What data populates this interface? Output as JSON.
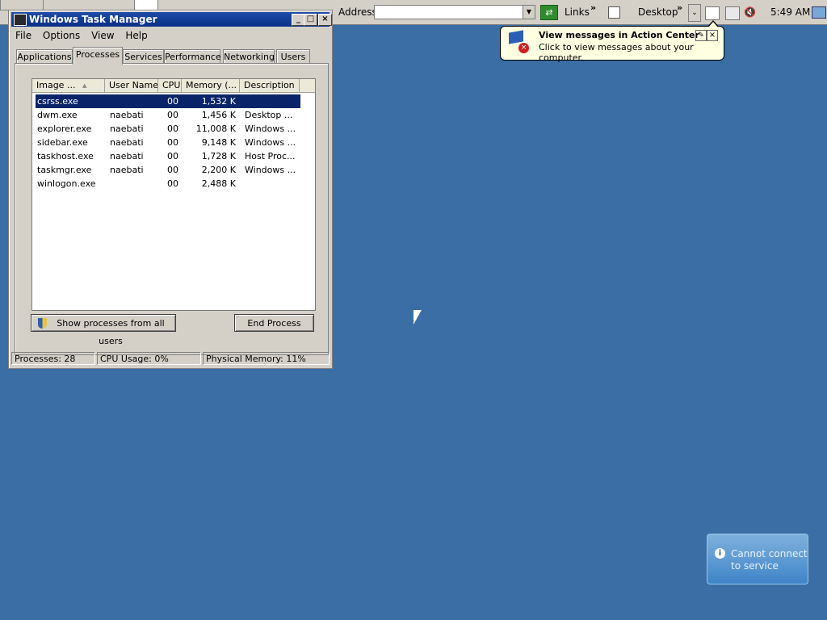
{
  "taskbar": {
    "address_label": "Address",
    "address_value": "",
    "links_label": "Links",
    "desktop_label": "Desktop",
    "chevron": "»",
    "clock": "5:49 AM"
  },
  "task_manager": {
    "title": "Windows Task Manager",
    "menu": [
      "File",
      "Options",
      "View",
      "Help"
    ],
    "tabs": [
      "Applications",
      "Processes",
      "Services",
      "Performance",
      "Networking",
      "Users"
    ],
    "active_tab": "Processes",
    "columns": [
      "Image ...",
      "User Name",
      "CPU",
      "Memory (...",
      "Description"
    ],
    "processes": [
      {
        "image": "csrss.exe",
        "user": "",
        "cpu": "00",
        "memory": "1,532 K",
        "description": ""
      },
      {
        "image": "dwm.exe",
        "user": "naebati",
        "cpu": "00",
        "memory": "1,456 K",
        "description": "Desktop ..."
      },
      {
        "image": "explorer.exe",
        "user": "naebati",
        "cpu": "00",
        "memory": "11,008 K",
        "description": "Windows ..."
      },
      {
        "image": "sidebar.exe",
        "user": "naebati",
        "cpu": "00",
        "memory": "9,148 K",
        "description": "Windows ..."
      },
      {
        "image": "taskhost.exe",
        "user": "naebati",
        "cpu": "00",
        "memory": "1,728 K",
        "description": "Host Proc..."
      },
      {
        "image": "taskmgr.exe",
        "user": "naebati",
        "cpu": "00",
        "memory": "2,200 K",
        "description": "Windows ..."
      },
      {
        "image": "winlogon.exe",
        "user": "",
        "cpu": "00",
        "memory": "2,488 K",
        "description": ""
      }
    ],
    "show_all_button": "Show processes from all users",
    "end_process_button": "End Process",
    "status": {
      "processes": "Processes: 28",
      "cpu": "CPU Usage: 0%",
      "memory": "Physical Memory: 11%"
    }
  },
  "balloon": {
    "title": "View messages in Action Center",
    "body": "Click to view messages about your computer."
  },
  "notification": {
    "text_line1": "Cannot connect",
    "text_line2": "to service"
  },
  "colors": {
    "desktop": "#3a6ea5",
    "title_bar": "#0a2f86",
    "selection": "#0a246a",
    "balloon_bg": "#ffffe1"
  }
}
